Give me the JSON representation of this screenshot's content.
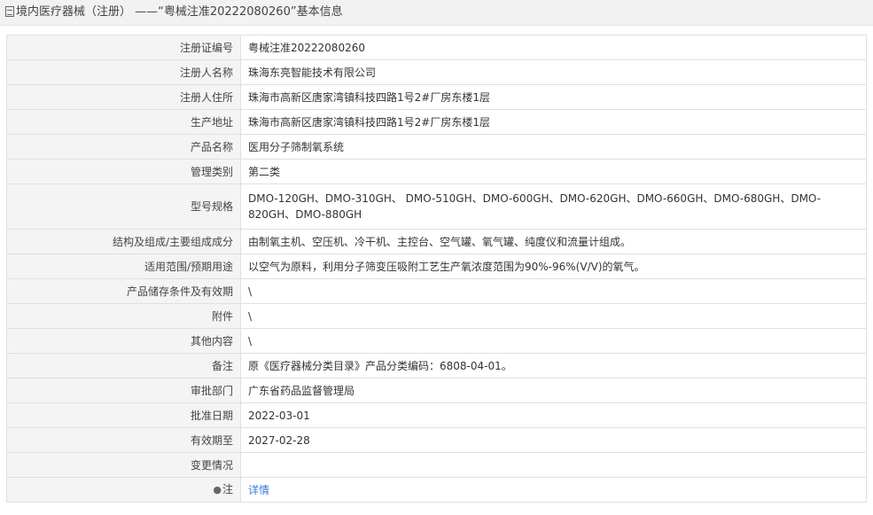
{
  "header": {
    "title": "境内医疗器械（注册） ——“粤械注准20222080260”基本信息",
    "icon": "document-icon"
  },
  "rows": [
    {
      "label": "注册证编号",
      "value": "粤械注准20222080260"
    },
    {
      "label": "注册人名称",
      "value": "珠海东亮智能技术有限公司"
    },
    {
      "label": "注册人住所",
      "value": "珠海市高新区唐家湾镇科技四路1号2#厂房东楼1层"
    },
    {
      "label": "生产地址",
      "value": "珠海市高新区唐家湾镇科技四路1号2#厂房东楼1层"
    },
    {
      "label": "产品名称",
      "value": "医用分子筛制氧系统"
    },
    {
      "label": "管理类别",
      "value": "第二类"
    },
    {
      "label": "型号规格",
      "value": "DMO-120GH、DMO-310GH、 DMO-510GH、DMO-600GH、DMO-620GH、DMO-660GH、DMO-680GH、DMO-820GH、DMO-880GH"
    },
    {
      "label": "结构及组成/主要组成成分",
      "value": "由制氧主机、空压机、冷干机、主控台、空气罐、氧气罐、纯度仪和流量计组成。"
    },
    {
      "label": "适用范围/预期用途",
      "value": "以空气为原料，利用分子筛变压吸附工艺生产氧浓度范围为90%-96%(V/V)的氧气。"
    },
    {
      "label": "产品储存条件及有效期",
      "value": "\\"
    },
    {
      "label": "附件",
      "value": "\\"
    },
    {
      "label": "其他内容",
      "value": "\\"
    },
    {
      "label": "备注",
      "value": "原《医疗器械分类目录》产品分类编码：6808-04-01。"
    },
    {
      "label": "审批部门",
      "value": "广东省药品监督管理局"
    },
    {
      "label": "批准日期",
      "value": "2022-03-01"
    },
    {
      "label": "有效期至",
      "value": "2027-02-28"
    },
    {
      "label": "变更情况",
      "value": ""
    }
  ],
  "note": {
    "label": "注",
    "icon": "lightbulb-icon",
    "link_text": "详情",
    "link_color": "#3a7bd5"
  }
}
